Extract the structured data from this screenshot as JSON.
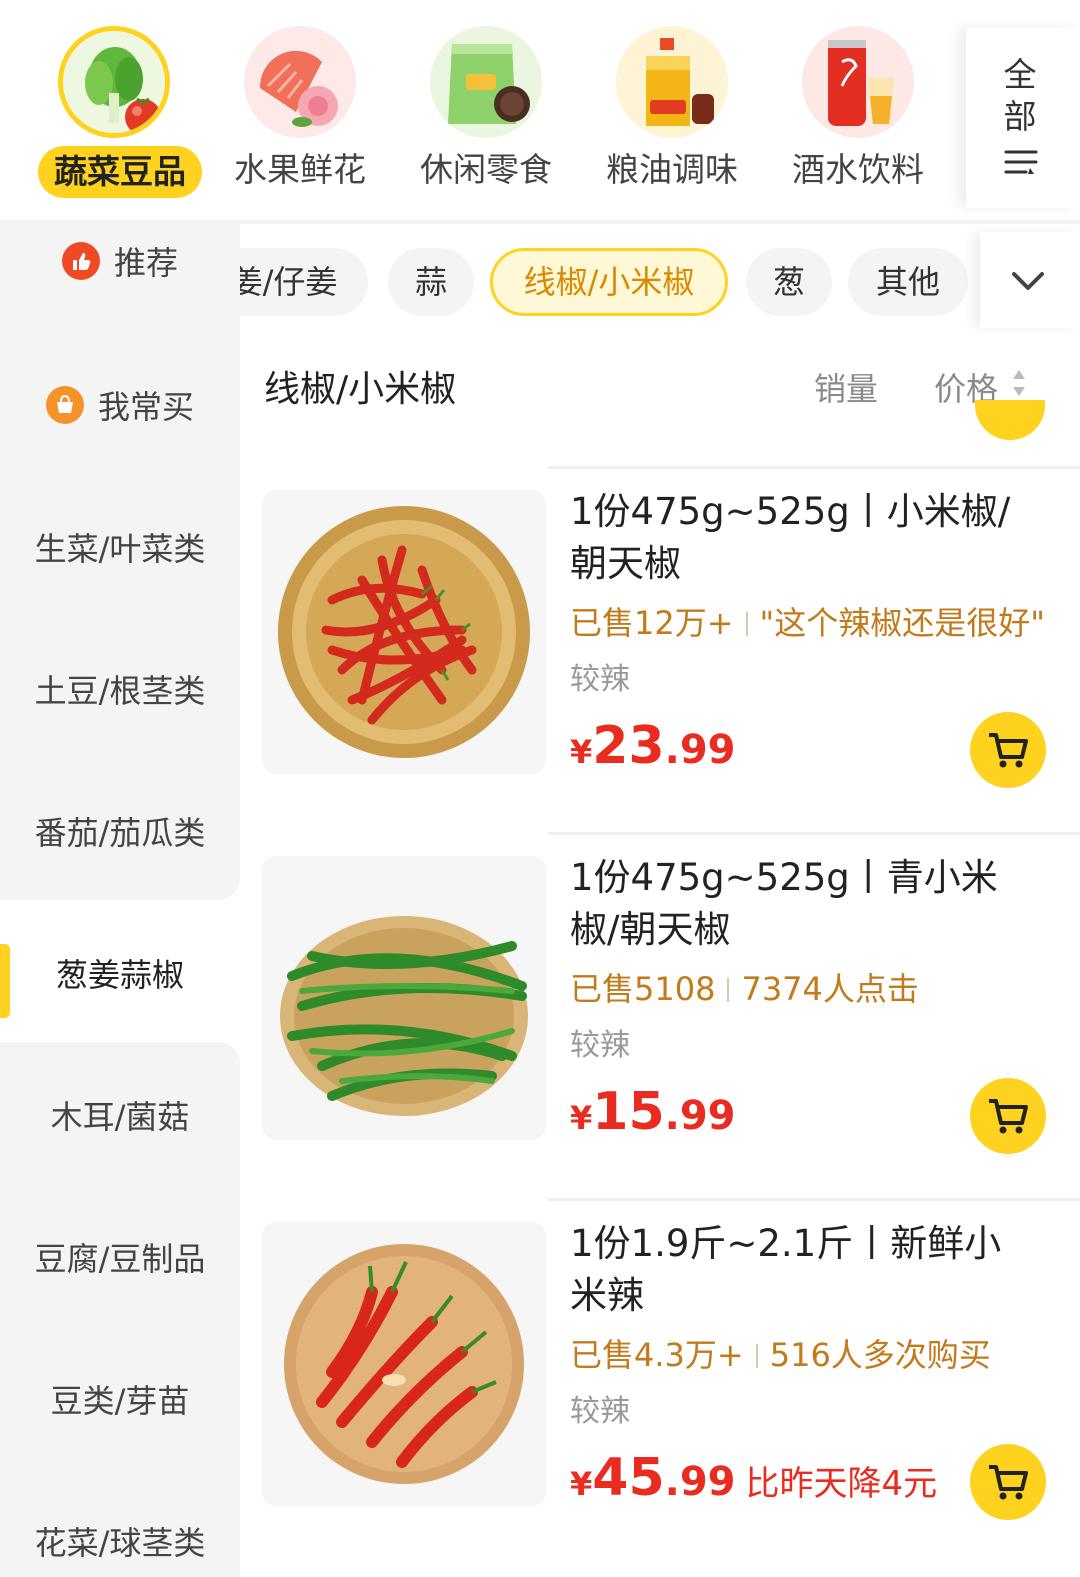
{
  "top_categories": [
    {
      "label": "蔬菜豆品",
      "icon": "vegetable-icon",
      "active": true
    },
    {
      "label": "水果鲜花",
      "icon": "fruit-flower-icon",
      "active": false
    },
    {
      "label": "休闲零食",
      "icon": "snack-icon",
      "active": false
    },
    {
      "label": "粮油调味",
      "icon": "oil-seasoning-icon",
      "active": false
    },
    {
      "label": "酒水饮料",
      "icon": "drink-icon",
      "active": false
    }
  ],
  "all_button": {
    "line1": "全",
    "line2": "部"
  },
  "sidebar": [
    {
      "label": "推荐",
      "icon": "thumbs-up-icon"
    },
    {
      "label": "我常买",
      "icon": "basket-icon"
    },
    {
      "label": "生菜/叶菜类"
    },
    {
      "label": "土豆/根茎类"
    },
    {
      "label": "番茄/茄瓜类"
    },
    {
      "label": "葱姜蒜椒",
      "active": true
    },
    {
      "label": "木耳/菌菇"
    },
    {
      "label": "豆腐/豆制品"
    },
    {
      "label": "豆类/芽苗"
    },
    {
      "label": "花菜/球茎类"
    }
  ],
  "sub_tabs": [
    {
      "label": "姜/仔姜"
    },
    {
      "label": "蒜"
    },
    {
      "label": "线椒/小米椒",
      "active": true
    },
    {
      "label": "葱"
    },
    {
      "label": "其他"
    }
  ],
  "list_header": {
    "title": "线椒/小米椒",
    "sort_sales": "销量",
    "sort_price": "价格"
  },
  "products": [
    {
      "name": "1份475g~525g丨小米椒/朝天椒",
      "sold": "已售12万+",
      "highlight": "\"这个辣椒还是很好\"",
      "tag": "较辣",
      "currency": "¥",
      "price_int": "23",
      "price_dec": ".99",
      "note": ""
    },
    {
      "name": "1份475g~525g丨青小米椒/朝天椒",
      "sold": "已售5108",
      "highlight": "7374人点击",
      "tag": "较辣",
      "currency": "¥",
      "price_int": "15",
      "price_dec": ".99",
      "note": ""
    },
    {
      "name": "1份1.9斤~2.1斤丨新鲜小米辣",
      "sold": "已售4.3万+",
      "highlight": "516人多次购买",
      "tag": "较辣",
      "currency": "¥",
      "price_int": "45",
      "price_dec": ".99",
      "note": "比昨天降4元"
    }
  ],
  "colors": {
    "accent": "#ffd21f",
    "price": "#ea2b1f",
    "sold": "#c27a1b"
  }
}
